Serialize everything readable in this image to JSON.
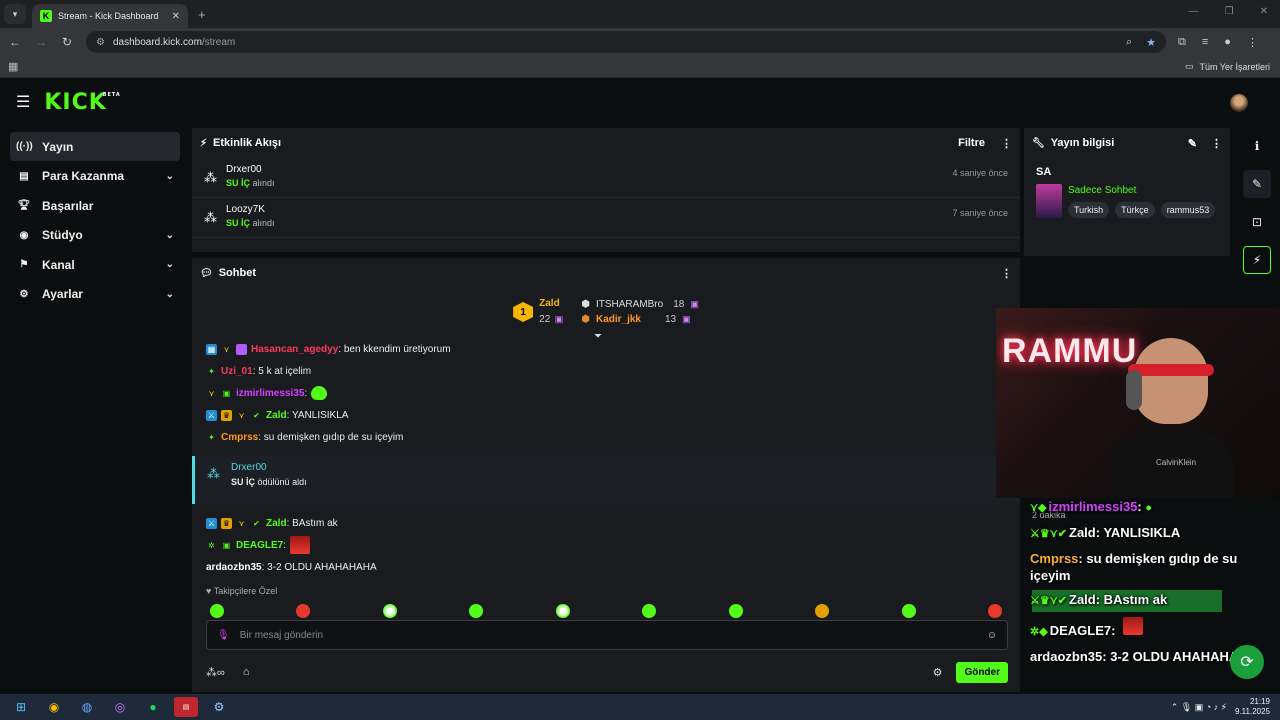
{
  "browser": {
    "tab_title": "Stream - Kick Dashboard",
    "tab_icon": "K",
    "url_host": "dashboard.kick.com",
    "url_path": "/stream",
    "bookmarks_label": "Tüm Yer İşaretleri"
  },
  "header": {
    "logo": "KICK",
    "beta": "BETA"
  },
  "sidebar": {
    "items": [
      {
        "label": "Yayın",
        "icon": "broadcast-icon",
        "active": true
      },
      {
        "label": "Para Kazanma",
        "icon": "monetize-icon",
        "expandable": true
      },
      {
        "label": "Başarılar",
        "icon": "trophy-icon"
      },
      {
        "label": "Stüdyo",
        "icon": "studio-icon",
        "expandable": true
      },
      {
        "label": "Kanal",
        "icon": "channel-icon",
        "expandable": true
      },
      {
        "label": "Ayarlar",
        "icon": "gear-icon",
        "expandable": true
      }
    ]
  },
  "activity": {
    "title": "Etkinlik Akışı",
    "filter": "Filtre",
    "events": [
      {
        "user": "Drxer00",
        "reward": "SU İÇ",
        "action": "alındı",
        "time": "4 saniye önce"
      },
      {
        "user": "Loozy7K",
        "reward": "SU İÇ",
        "action": "alındı",
        "time": "7 saniye önce"
      }
    ]
  },
  "chat": {
    "title": "Sohbet",
    "leaderboard": [
      {
        "rank": "1",
        "name": "Zald",
        "count": "22"
      },
      {
        "name": "ITSHARAMBro",
        "count": "18"
      },
      {
        "name": "Kadir_jkk",
        "count": "13"
      }
    ],
    "messages": [
      {
        "user": "Hasancan_agedyy",
        "text": ": ben kkendim üretiyorum"
      },
      {
        "user": "Uzi_01",
        "text": ": 5 k at içelim"
      },
      {
        "user": "izmirlimessi35",
        "text": ":"
      },
      {
        "user": "Zald",
        "text": ": YANLISIKLA"
      },
      {
        "user": "Cmprss",
        "text": ": su demişken gıdıp de su içeyim"
      }
    ],
    "reward_event": {
      "user": "Drxer00",
      "reward": "SU İÇ",
      "text": "ödülünü aldı"
    },
    "messages2": [
      {
        "user": "Zald",
        "text": ": BAstım ak"
      },
      {
        "user": "DEAGLE7",
        "text": ":"
      },
      {
        "user": "ardaozbn35",
        "text": ": 3-2 OLDU AHAHAHAHA"
      }
    ],
    "followers_only": "Takipçilere Özel",
    "input_placeholder": "Bir mesaj gönderin",
    "send": "Gönder"
  },
  "stream_info": {
    "title": "Yayın bilgisi",
    "stream_title": "SA",
    "category": "Sadece Sohbet",
    "tags": [
      "Turkish",
      "Türkçe",
      "rammus53"
    ]
  },
  "webcam": {
    "neon_text": "RAMMU",
    "shirt": "CalvinKlein"
  },
  "overlay": {
    "lines": [
      {
        "user": "izmirlimessi35",
        "text": ":"
      },
      {
        "user": "Zald",
        "text": ": YANLISIKLA"
      },
      {
        "user": "Cmprss",
        "text": ": su demişken gıdıp de su içeyim"
      },
      {
        "user": "Zald",
        "text": ": BAstım ak"
      },
      {
        "user": "DEAGLE7",
        "text": ":"
      },
      {
        "user": "ardaozbn35",
        "text": ": 3-2 OLDU AHAHAHAHA"
      }
    ],
    "ghost": "2 dakika"
  },
  "taskbar": {
    "time": "21:19",
    "date": "9.11.2025"
  },
  "colors": {
    "brand": "#53fc18",
    "panel": "#191b1f",
    "bg": "#0b0e0f"
  }
}
